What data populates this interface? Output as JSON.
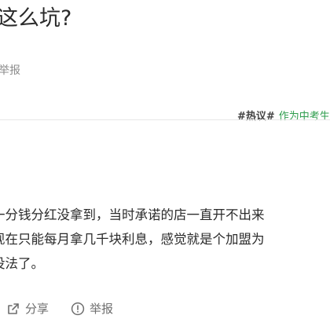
{
  "question": {
    "title": "这么坑?"
  },
  "top_actions": {
    "report_label": "举报"
  },
  "topic": {
    "tag": "#热议#",
    "text": "作为中考生"
  },
  "answer": {
    "lines": [
      "一分钱分红没拿到，当时承诺的店一直开不出来",
      "现在只能每月拿几千块利息，感觉就是个加盟为",
      "没法了。"
    ]
  },
  "answer_actions": {
    "share_label": "分享",
    "report_label": "举报"
  },
  "icons": {
    "share": "share-icon",
    "report": "warning-circle-icon"
  },
  "colors": {
    "topic_green": "#2e9d4d",
    "muted_gray": "#8c8c8c"
  }
}
